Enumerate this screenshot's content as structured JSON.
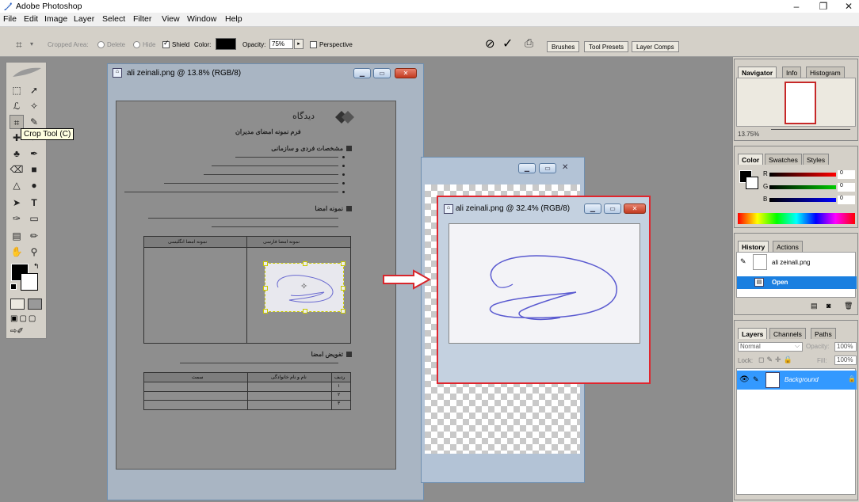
{
  "app": {
    "title": "Adobe Photoshop",
    "window_controls": [
      "–",
      "❐",
      "✕"
    ]
  },
  "menu": [
    "File",
    "Edit",
    "Image",
    "Layer",
    "Select",
    "Filter",
    "View",
    "Window",
    "Help"
  ],
  "options_bar": {
    "cropped_areas_label": "Cropped Area:",
    "delete_label": "Delete",
    "hide_label": "Hide",
    "shield_label": "Shield",
    "color_label": "Color:",
    "opacity_label": "Opacity:",
    "opacity_value": "75%",
    "perspective_label": "Perspective",
    "palette_tabs": [
      "Brushes",
      "Tool Presets",
      "Layer Comps"
    ]
  },
  "tooltip": "Crop Tool (C)",
  "windows": {
    "main_title": "ali zeinali.png @ 13.8% (RGB/8)",
    "crop_title": "ali zeinali.png @ 32.4% (RGB/8)"
  },
  "navigator": {
    "tabs": [
      "Navigator",
      "Info",
      "Histogram"
    ],
    "zoom": "13.75%"
  },
  "color_panel": {
    "tabs": [
      "Color",
      "Swatches",
      "Styles"
    ],
    "channels": [
      {
        "label": "R",
        "value": "0",
        "color": "#ff0000"
      },
      {
        "label": "G",
        "value": "0",
        "color": "#00c000"
      },
      {
        "label": "B",
        "value": "0",
        "color": "#0000ff"
      }
    ]
  },
  "history_panel": {
    "tabs": [
      "History",
      "Actions"
    ],
    "snapshot": "ali zeinali.png",
    "step": "Open"
  },
  "layers_panel": {
    "tabs": [
      "Layers",
      "Channels",
      "Paths"
    ],
    "blend_mode": "Normal",
    "opacity_label": "Opacity:",
    "opacity_value": "100%",
    "lock_label": "Lock:",
    "fill_label": "Fill:",
    "fill_value": "100%",
    "layer_name": "Background"
  },
  "document": {
    "logo_text": "دیدگاه",
    "form_title": "فرم نمونه امضای مدیران",
    "section1": "مشخصات فردی و سازمانی",
    "section2": "نمونه امضا",
    "section3": "تفویض امضا",
    "table_col_persian": "نمونه امضا فارسی",
    "table_col_english": "نمونه امضا انگلیسی",
    "table2_headers": [
      "ردیف",
      "نام و نام خانوادگی",
      "سمت"
    ],
    "table2_rows": [
      "۱",
      "۲",
      "۳"
    ]
  },
  "colors": {
    "accent_blue": "#3399ff",
    "highlight_red": "#e0252d",
    "history_selected": "#1a7fe0"
  }
}
